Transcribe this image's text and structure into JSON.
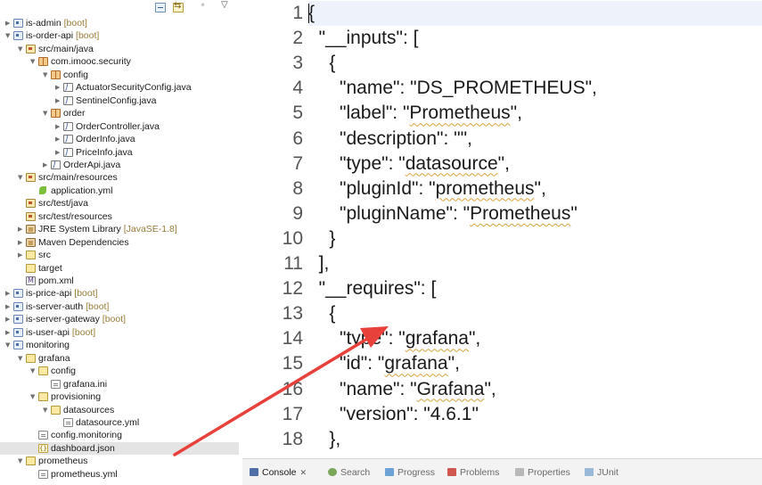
{
  "explorer": {
    "toolbar": {
      "collapse_icon": "collapse-all-icon",
      "link_icon": "link-with-editor-icon",
      "focus_icon": "focus-icon",
      "menu_icon": "view-menu-icon"
    },
    "items": [
      {
        "label": "is-admin",
        "decoration": "[boot]",
        "depth": 0,
        "twisty": "closed",
        "icon": "project",
        "name": "project-is-admin"
      },
      {
        "label": "is-order-api",
        "decoration": "[boot]",
        "depth": 0,
        "twisty": "open",
        "icon": "project",
        "name": "project-is-order-api"
      },
      {
        "label": "src/main/java",
        "decoration": "",
        "depth": 1,
        "twisty": "open",
        "icon": "pkgfolder",
        "name": "source-folder-main-java"
      },
      {
        "label": "com.imooc.security",
        "decoration": "",
        "depth": 2,
        "twisty": "open",
        "icon": "package",
        "name": "package-com-imooc-security"
      },
      {
        "label": "config",
        "decoration": "",
        "depth": 3,
        "twisty": "open",
        "icon": "package",
        "name": "package-config"
      },
      {
        "label": "ActuatorSecurityConfig.java",
        "decoration": "",
        "depth": 4,
        "twisty": "closed",
        "icon": "java",
        "name": "file-actuator-security-config"
      },
      {
        "label": "SentinelConfig.java",
        "decoration": "",
        "depth": 4,
        "twisty": "closed",
        "icon": "java",
        "name": "file-sentinel-config"
      },
      {
        "label": "order",
        "decoration": "",
        "depth": 3,
        "twisty": "open",
        "icon": "package",
        "name": "package-order"
      },
      {
        "label": "OrderController.java",
        "decoration": "",
        "depth": 4,
        "twisty": "closed",
        "icon": "java",
        "name": "file-order-controller"
      },
      {
        "label": "OrderInfo.java",
        "decoration": "",
        "depth": 4,
        "twisty": "closed",
        "icon": "java",
        "name": "file-order-info"
      },
      {
        "label": "PriceInfo.java",
        "decoration": "",
        "depth": 4,
        "twisty": "closed",
        "icon": "java",
        "name": "file-price-info"
      },
      {
        "label": "OrderApi.java",
        "decoration": "",
        "depth": 3,
        "twisty": "closed",
        "icon": "java",
        "name": "file-order-api"
      },
      {
        "label": "src/main/resources",
        "decoration": "",
        "depth": 1,
        "twisty": "open",
        "icon": "pkgfolder",
        "name": "source-folder-main-resources"
      },
      {
        "label": "application.yml",
        "decoration": "",
        "depth": 2,
        "twisty": "",
        "icon": "yml",
        "name": "file-application-yml"
      },
      {
        "label": "src/test/java",
        "decoration": "",
        "depth": 1,
        "twisty": "",
        "icon": "pkgfolder",
        "name": "source-folder-test-java"
      },
      {
        "label": "src/test/resources",
        "decoration": "",
        "depth": 1,
        "twisty": "",
        "icon": "pkgfolder",
        "name": "source-folder-test-resources"
      },
      {
        "label": "JRE System Library",
        "decoration": "[JavaSE-1.8]",
        "depth": 1,
        "twisty": "closed",
        "icon": "library",
        "name": "library-jre-system"
      },
      {
        "label": "Maven Dependencies",
        "decoration": "",
        "depth": 1,
        "twisty": "closed",
        "icon": "library",
        "name": "library-maven-dependencies"
      },
      {
        "label": "src",
        "decoration": "",
        "depth": 1,
        "twisty": "closed",
        "icon": "folder",
        "name": "folder-src"
      },
      {
        "label": "target",
        "decoration": "",
        "depth": 1,
        "twisty": "",
        "icon": "folder",
        "name": "folder-target"
      },
      {
        "label": "pom.xml",
        "decoration": "",
        "depth": 1,
        "twisty": "",
        "icon": "xml",
        "name": "file-pom-xml"
      },
      {
        "label": "is-price-api",
        "decoration": "[boot]",
        "depth": 0,
        "twisty": "closed",
        "icon": "project",
        "name": "project-is-price-api"
      },
      {
        "label": "is-server-auth",
        "decoration": "[boot]",
        "depth": 0,
        "twisty": "closed",
        "icon": "project",
        "name": "project-is-server-auth"
      },
      {
        "label": "is-server-gateway",
        "decoration": "[boot]",
        "depth": 0,
        "twisty": "closed",
        "icon": "project",
        "name": "project-is-server-gateway"
      },
      {
        "label": "is-user-api",
        "decoration": "[boot]",
        "depth": 0,
        "twisty": "closed",
        "icon": "project",
        "name": "project-is-user-api"
      },
      {
        "label": "monitoring",
        "decoration": "",
        "depth": 0,
        "twisty": "open",
        "icon": "project",
        "name": "project-monitoring"
      },
      {
        "label": "grafana",
        "decoration": "",
        "depth": 1,
        "twisty": "open",
        "icon": "folder",
        "name": "folder-grafana"
      },
      {
        "label": "config",
        "decoration": "",
        "depth": 2,
        "twisty": "open",
        "icon": "folder",
        "name": "folder-grafana-config"
      },
      {
        "label": "grafana.ini",
        "decoration": "",
        "depth": 3,
        "twisty": "",
        "icon": "file",
        "name": "file-grafana-ini"
      },
      {
        "label": "provisioning",
        "decoration": "",
        "depth": 2,
        "twisty": "open",
        "icon": "folder",
        "name": "folder-provisioning"
      },
      {
        "label": "datasources",
        "decoration": "",
        "depth": 3,
        "twisty": "open",
        "icon": "folder",
        "name": "folder-datasources"
      },
      {
        "label": "datasource.yml",
        "decoration": "",
        "depth": 4,
        "twisty": "",
        "icon": "file",
        "name": "file-datasource-yml"
      },
      {
        "label": "config.monitoring",
        "decoration": "",
        "depth": 2,
        "twisty": "",
        "icon": "file",
        "name": "file-config-monitoring"
      },
      {
        "label": "dashboard.json",
        "decoration": "",
        "depth": 2,
        "twisty": "",
        "icon": "json",
        "name": "file-dashboard-json",
        "selected": true
      },
      {
        "label": "prometheus",
        "decoration": "",
        "depth": 1,
        "twisty": "open",
        "icon": "folder",
        "name": "folder-prometheus"
      },
      {
        "label": "prometheus.yml",
        "decoration": "",
        "depth": 2,
        "twisty": "",
        "icon": "file",
        "name": "file-prometheus-yml"
      }
    ]
  },
  "editor": {
    "lines": [
      {
        "n": "1",
        "segments": [
          {
            "t": "{"
          }
        ]
      },
      {
        "n": "2",
        "segments": [
          {
            "t": "  \"__inputs\": ["
          }
        ]
      },
      {
        "n": "3",
        "segments": [
          {
            "t": "    {"
          }
        ]
      },
      {
        "n": "4",
        "segments": [
          {
            "t": "      \"name\": \"DS_PROMETHEUS\","
          }
        ]
      },
      {
        "n": "5",
        "segments": [
          {
            "t": "      \"label\": \""
          },
          {
            "t": "Prometheus",
            "sq": true
          },
          {
            "t": "\","
          }
        ]
      },
      {
        "n": "6",
        "segments": [
          {
            "t": "      \"description\": \"\","
          }
        ]
      },
      {
        "n": "7",
        "segments": [
          {
            "t": "      \"type\": \""
          },
          {
            "t": "datasource",
            "sq": true
          },
          {
            "t": "\","
          }
        ]
      },
      {
        "n": "8",
        "segments": [
          {
            "t": "      \"pluginId\": \""
          },
          {
            "t": "prometheus",
            "sq": true
          },
          {
            "t": "\","
          }
        ]
      },
      {
        "n": "9",
        "segments": [
          {
            "t": "      \"pluginName\": \""
          },
          {
            "t": "Prometheus",
            "sq": true
          },
          {
            "t": "\""
          }
        ]
      },
      {
        "n": "10",
        "segments": [
          {
            "t": "    }"
          }
        ]
      },
      {
        "n": "11",
        "segments": [
          {
            "t": "  ],"
          }
        ]
      },
      {
        "n": "12",
        "segments": [
          {
            "t": "  \"__requires\": ["
          }
        ]
      },
      {
        "n": "13",
        "segments": [
          {
            "t": "    {"
          }
        ]
      },
      {
        "n": "14",
        "segments": [
          {
            "t": "      \"type\": \""
          },
          {
            "t": "grafana",
            "sq": true
          },
          {
            "t": "\","
          }
        ]
      },
      {
        "n": "15",
        "segments": [
          {
            "t": "      \"id\": \""
          },
          {
            "t": "grafana",
            "sq": true
          },
          {
            "t": "\","
          }
        ]
      },
      {
        "n": "16",
        "segments": [
          {
            "t": "      \"name\": \""
          },
          {
            "t": "Grafana",
            "sq": true
          },
          {
            "t": "\","
          }
        ]
      },
      {
        "n": "17",
        "segments": [
          {
            "t": "      \"version\": \"4.6.1\""
          }
        ]
      },
      {
        "n": "18",
        "segments": [
          {
            "t": "    },"
          }
        ]
      }
    ]
  },
  "console": {
    "tabs": [
      {
        "label": "Console",
        "icon": "console",
        "active": true,
        "closable": true,
        "name": "tab-console"
      },
      {
        "label": "Search",
        "icon": "search",
        "active": false,
        "closable": false,
        "name": "tab-search"
      },
      {
        "label": "Progress",
        "icon": "progress",
        "active": false,
        "closable": false,
        "name": "tab-progress"
      },
      {
        "label": "Problems",
        "icon": "problems",
        "active": false,
        "closable": false,
        "name": "tab-problems"
      },
      {
        "label": "Properties",
        "icon": "properties",
        "active": false,
        "closable": false,
        "name": "tab-properties"
      },
      {
        "label": "JUnit",
        "icon": "junit",
        "active": false,
        "closable": false,
        "name": "tab-junit"
      }
    ],
    "close_glyph": "✕"
  },
  "colors": {
    "annotation_arrow": "#e8403a",
    "selection": "#e4e4e4",
    "squiggle": "#d6a23a"
  }
}
